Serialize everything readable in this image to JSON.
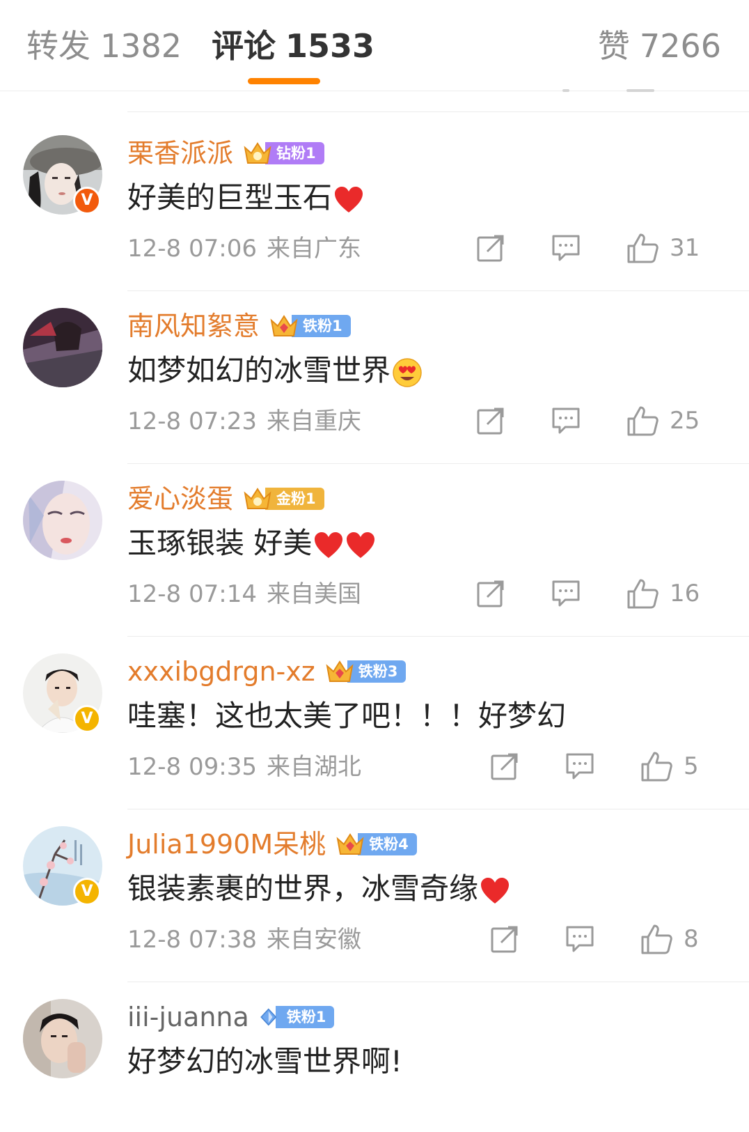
{
  "tabs": {
    "reposts": {
      "label": "转发",
      "count": "1382"
    },
    "comments": {
      "label": "评论",
      "count": "1533"
    },
    "likes": {
      "label": "赞",
      "count": "7266"
    }
  },
  "colors": {
    "accent": "#ff8200",
    "username": "#e37c2c",
    "verified_red": "#f25a0c",
    "verified_gold": "#f4b400"
  },
  "comments": [
    {
      "username": "栗香派派",
      "fan_badge": "钻粉1",
      "fan_badge_type": "diamond",
      "text": "好美的巨型玉石",
      "emojis": [
        "red-heart"
      ],
      "time": "12-8 07:06",
      "location": "来自广东",
      "likes": "31",
      "verified": "red"
    },
    {
      "username": "南风知絮意",
      "fan_badge": "铁粉1",
      "fan_badge_type": "iron",
      "text": "如梦如幻的冰雪世界",
      "emojis": [
        "heart-eyes-face"
      ],
      "time": "12-8 07:23",
      "location": "来自重庆",
      "likes": "25",
      "verified": ""
    },
    {
      "username": "爱心淡蛋",
      "fan_badge": "金粉1",
      "fan_badge_type": "gold",
      "text": "玉琢银装 好美",
      "emojis": [
        "red-heart",
        "red-heart"
      ],
      "time": "12-8 07:14",
      "location": "来自美国",
      "likes": "16",
      "verified": ""
    },
    {
      "username": "xxxibgdrgn-xz",
      "fan_badge": "铁粉3",
      "fan_badge_type": "iron",
      "text": "哇塞！这也太美了吧！！！好梦幻",
      "emojis": [],
      "time": "12-8 09:35",
      "location": "来自湖北",
      "likes": "5",
      "verified": "gold"
    },
    {
      "username": "Julia1990M呆桃",
      "fan_badge": "铁粉4",
      "fan_badge_type": "iron",
      "text": "银装素裹的世界，冰雪奇缘",
      "emojis": [
        "red-heart"
      ],
      "time": "12-8 07:38",
      "location": "来自安徽",
      "likes": "8",
      "verified": "gold"
    },
    {
      "username": "iii-juanna",
      "fan_badge": "铁粉1",
      "fan_badge_type": "iron-diamond",
      "text": "好梦幻的冰雪世界啊!",
      "emojis": [],
      "time": "",
      "location": "",
      "likes": "",
      "verified": ""
    }
  ]
}
